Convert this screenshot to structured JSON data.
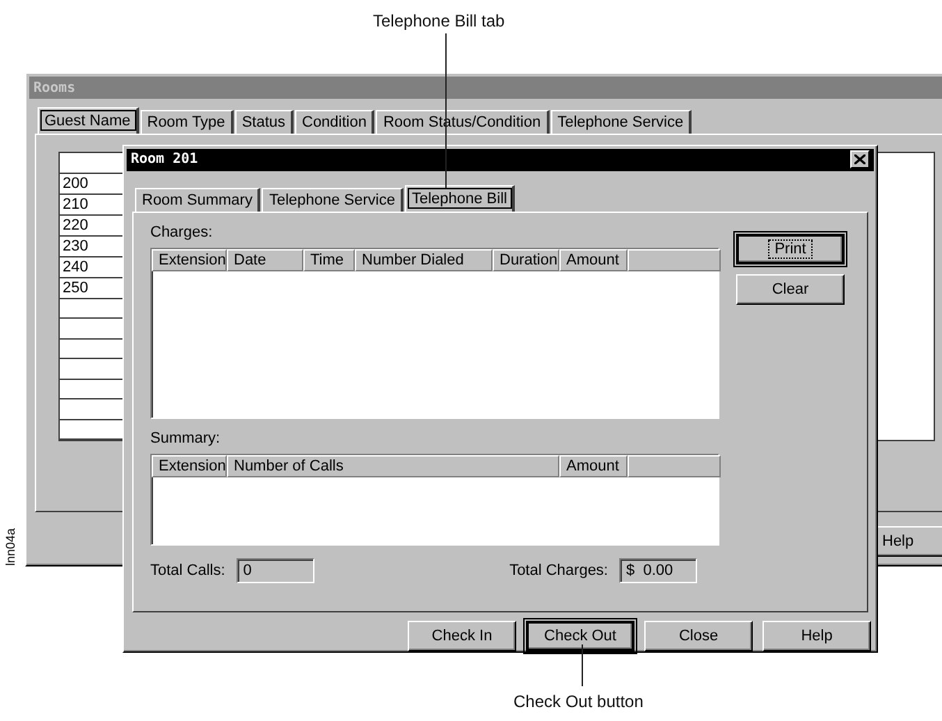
{
  "callouts": [
    {
      "label": "Telephone Bill tab"
    },
    {
      "label": "Check Out button"
    }
  ],
  "figure_id": "lnn04a",
  "rooms_window": {
    "title": "Rooms",
    "tabs": [
      {
        "label": "Guest Name",
        "selected": true
      },
      {
        "label": "Room Type",
        "selected": false
      },
      {
        "label": "Status",
        "selected": false
      },
      {
        "label": "Condition",
        "selected": false
      },
      {
        "label": "Room Status/Condition",
        "selected": false
      },
      {
        "label": "Telephone Service",
        "selected": false
      }
    ],
    "rows": [
      "200",
      "210",
      "220",
      "230",
      "240",
      "250"
    ],
    "help_button": "Help"
  },
  "dialog": {
    "title": "Room 201",
    "tabs": [
      {
        "label": "Room Summary",
        "selected": false
      },
      {
        "label": "Telephone Service",
        "selected": false
      },
      {
        "label": "Telephone Bill",
        "selected": true
      }
    ],
    "charges": {
      "label": "Charges:",
      "columns": [
        "Extension",
        "Date",
        "Time",
        "Number Dialed",
        "Duration",
        "Amount"
      ]
    },
    "side_buttons": [
      {
        "label": "Print",
        "focused": true
      },
      {
        "label": "Clear",
        "focused": false
      }
    ],
    "summary": {
      "label": "Summary:",
      "columns": [
        "Extension",
        "Number of Calls",
        "Amount"
      ]
    },
    "total_calls": {
      "label": "Total Calls:",
      "value": "0"
    },
    "total_charges": {
      "label": "Total Charges:",
      "value": "$  0.00"
    },
    "buttons": [
      {
        "label": "Check In",
        "focused": false
      },
      {
        "label": "Check Out",
        "focused": true
      },
      {
        "label": "Close",
        "focused": false
      },
      {
        "label": "Help",
        "focused": false
      }
    ]
  }
}
